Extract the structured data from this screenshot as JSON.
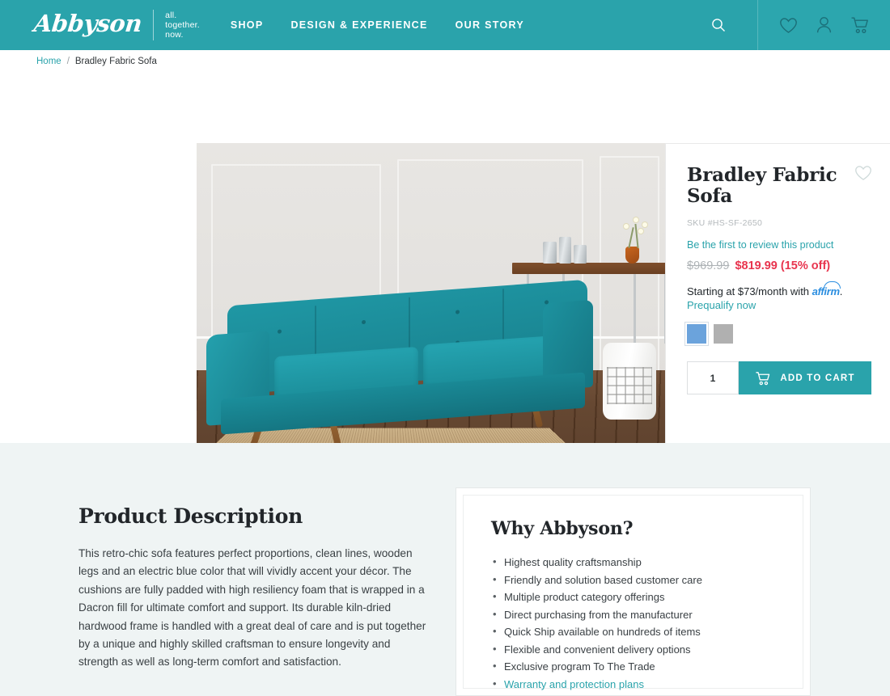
{
  "header": {
    "logo_name": "Abbyson",
    "logo_tagline_line1": "all.",
    "logo_tagline_line2": "together.",
    "logo_tagline_line3": "now.",
    "nav": [
      {
        "label": "SHOP"
      },
      {
        "label": "DESIGN & EXPERIENCE"
      },
      {
        "label": "OUR STORY"
      }
    ],
    "icons": {
      "search": "search-icon",
      "wishlist": "heart-icon",
      "account": "user-icon",
      "cart": "cart-icon"
    },
    "bg_color": "#2aa3ab"
  },
  "breadcrumb": {
    "home": "Home",
    "separator": "/",
    "current": "Bradley Fabric Sofa"
  },
  "product": {
    "title": "Bradley Fabric Sofa",
    "sku": "SKU #HS-SF-2650",
    "review_link": "Be the first to review this product",
    "price_old": "$969.99",
    "price_new": "$819.99 (15% off)",
    "affirm_prefix": "Starting at $73/month with",
    "affirm_logo": "affirm",
    "affirm_suffix": ".",
    "prequalify": "Prequalify now",
    "wishlist_icon": "heart-icon",
    "swatches": [
      {
        "name": "blue",
        "color": "#6ba3dc",
        "selected": true
      },
      {
        "name": "gray",
        "color": "#b0b0b0",
        "selected": false
      }
    ],
    "quantity": "1",
    "add_to_cart": "ADD TO CART",
    "accent_color": "#2aa3ab",
    "sale_color": "#e8344e"
  },
  "gallery": {
    "prev_icon": "chevron-left-icon",
    "thumbnails": [
      {
        "alt": "sofa-back-closeup"
      },
      {
        "alt": "sofa-full-room"
      },
      {
        "alt": "sofa-tufting-detail"
      },
      {
        "alt": "sofa-seat-corner"
      },
      {
        "alt": "sofa-leg-detail"
      },
      {
        "alt": "sofa-arm-detail"
      }
    ]
  },
  "description": {
    "title": "Product Description",
    "body": "This retro-chic sofa features perfect proportions, clean lines, wooden legs and an electric blue color that will vividly accent your décor. The cushions are fully padded with high resiliency foam that is wrapped in a Dacron fill for ultimate comfort and support. Its durable kiln-dried hardwood frame is handled with a great deal of care and is put together by a unique and highly skilled craftsman to ensure longevity and strength as well as long-term comfort and satisfaction."
  },
  "why": {
    "title": "Why Abbyson?",
    "items": [
      {
        "text": "Highest quality craftsmanship",
        "link": false
      },
      {
        "text": "Friendly and solution based customer care",
        "link": false
      },
      {
        "text": "Multiple product category offerings",
        "link": false
      },
      {
        "text": "Direct purchasing from the manufacturer",
        "link": false
      },
      {
        "text": "Quick Ship available on hundreds of items",
        "link": false
      },
      {
        "text": "Flexible and convenient delivery options",
        "link": false
      },
      {
        "text": "Exclusive program To The Trade",
        "link": false
      },
      {
        "text": "Warranty and protection plans",
        "link": true
      }
    ]
  }
}
